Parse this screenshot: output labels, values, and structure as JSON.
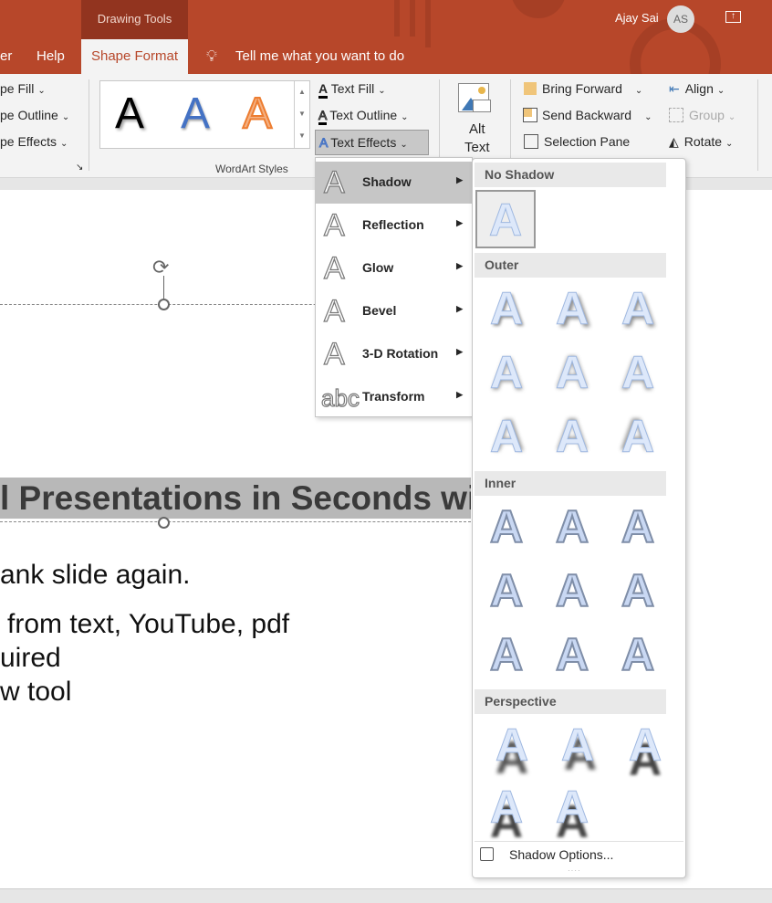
{
  "titlebar": {
    "context_tab": "Drawing Tools",
    "user_name": "Ajay Sai",
    "avatar_initials": "AS",
    "accent": "#b7472a"
  },
  "tabs": {
    "partial": "er",
    "help": "Help",
    "shape_format": "Shape Format",
    "tell_me": "Tell me what you want to do"
  },
  "ribbon": {
    "shape_styles": {
      "fill": "pe Fill",
      "outline": "pe Outline",
      "effects": "pe Effects"
    },
    "wordart": {
      "group_label": "WordArt Styles",
      "sample": "A",
      "text_fill": "Text Fill",
      "text_outline": "Text Outline",
      "text_effects": "Text Effects"
    },
    "alt_text": {
      "line1": "Alt",
      "line2": "Text"
    },
    "arrange": {
      "bring_forward": "Bring Forward",
      "send_backward": "Send Backward",
      "selection_pane": "Selection Pane",
      "align": "Align",
      "group": "Group",
      "rotate": "Rotate"
    }
  },
  "slide": {
    "title": "l Presentations in Seconds with",
    "lines": [
      "ank slide again.",
      "from text, YouTube, pdf",
      "uired",
      "w tool"
    ]
  },
  "text_effects_menu": {
    "items": [
      {
        "label": "Shadow",
        "icon": "A",
        "selected": true
      },
      {
        "label": "Reflection",
        "icon": "A"
      },
      {
        "label": "Glow",
        "icon": "A"
      },
      {
        "label": "Bevel",
        "icon": "A"
      },
      {
        "label": "3-D Rotation",
        "icon": "A"
      },
      {
        "label": "Transform",
        "icon": "abc"
      }
    ]
  },
  "shadow_gallery": {
    "glyph": "A",
    "sections": [
      {
        "title": "No Shadow",
        "count": 1
      },
      {
        "title": "Outer",
        "count": 9
      },
      {
        "title": "Inner",
        "count": 9
      },
      {
        "title": "Perspective",
        "count": 5
      }
    ],
    "options": "Shadow Options..."
  }
}
